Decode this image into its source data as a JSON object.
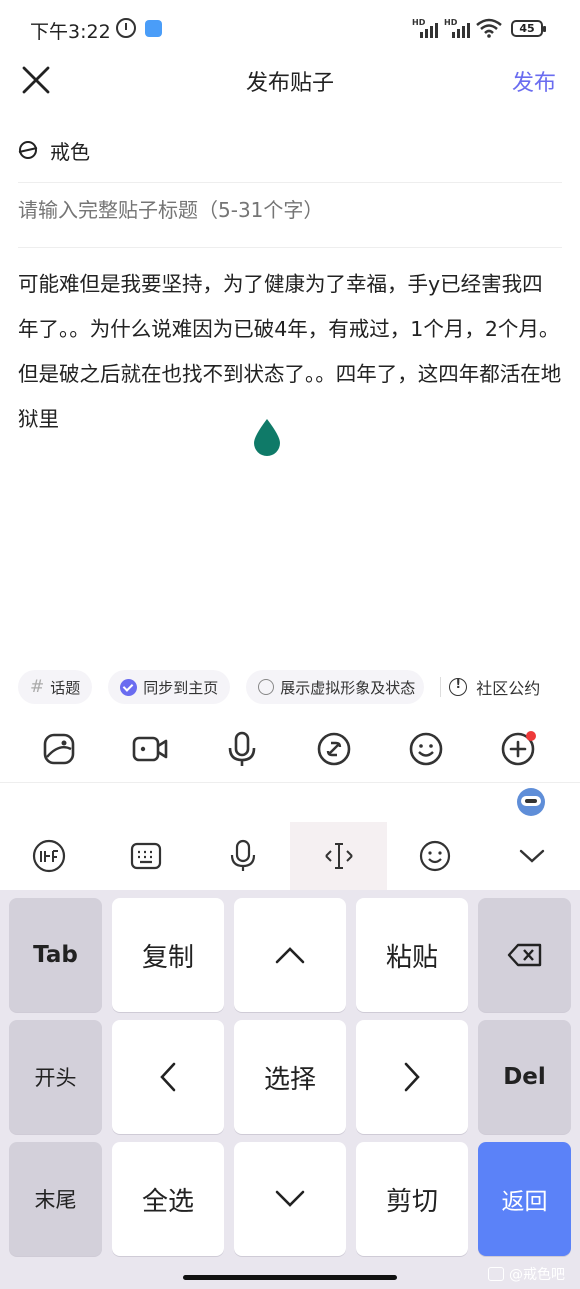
{
  "status": {
    "time": "下午3:22",
    "hd1": "HD",
    "hd2": "HD",
    "battery": "45"
  },
  "header": {
    "title": "发布贴子",
    "publish_label": "发布"
  },
  "forum": {
    "name": "戒色"
  },
  "title_input": {
    "placeholder": "请输入完整贴子标题（5-31个字）"
  },
  "content": {
    "text": "可能难但是我要坚持，为了健康为了幸福，手y已经害我四年了。。为什么说难因为已破4年，有戒过，1个月，2个月。但是破之后就在也找不到状态了。。四年了，这四年都活在地狱里"
  },
  "chips": {
    "topic": "话题",
    "sync": "同步到主页",
    "avatar": "展示虚拟形象及状态",
    "rules": "社区公约"
  },
  "keyboard": {
    "keys": {
      "tab": "Tab",
      "copy": "复制",
      "paste": "粘贴",
      "home": "开头",
      "select": "选择",
      "del": "Del",
      "end": "末尾",
      "select_all": "全选",
      "cut": "剪切",
      "back": "返回"
    }
  },
  "watermark": "@戒色吧",
  "colors": {
    "accent": "#6a6cf0",
    "drop": "#0f7a68",
    "return_key": "#5b82f8"
  }
}
